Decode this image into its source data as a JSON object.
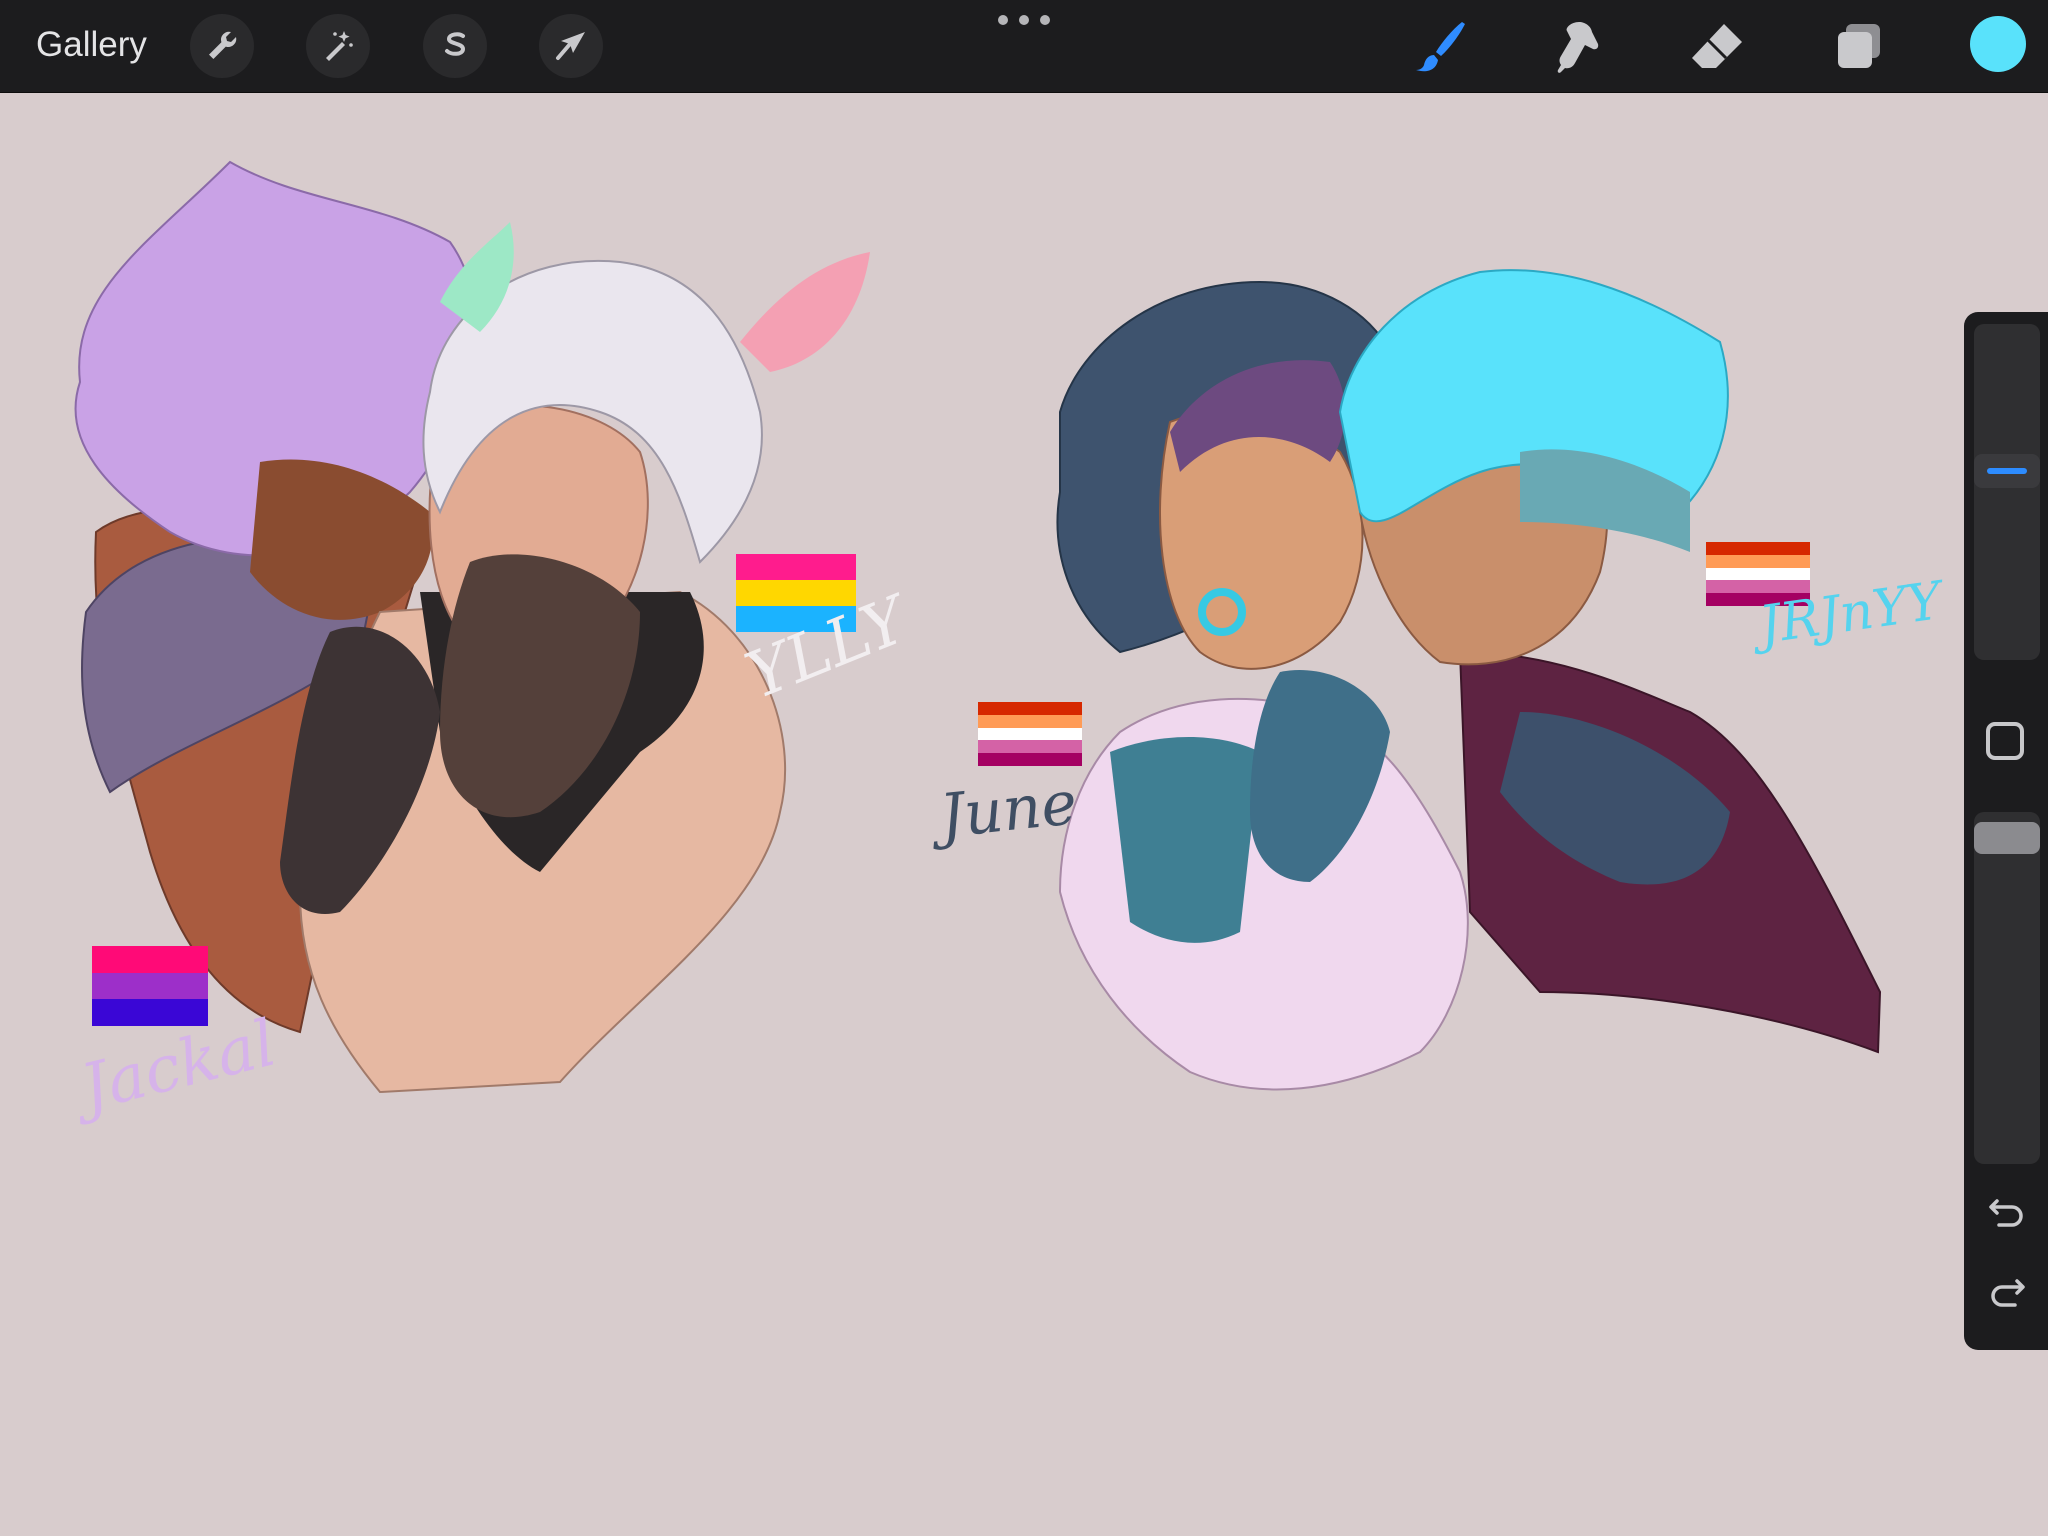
{
  "toolbar": {
    "gallery_label": "Gallery",
    "left_tools": [
      "wrench-icon",
      "magic-wand-icon",
      "selection-icon",
      "transform-arrow-icon"
    ],
    "right_tools": [
      "brush-icon",
      "smudge-icon",
      "eraser-icon",
      "layers-icon"
    ],
    "active_tool": "brush",
    "current_color": "#59e2fb"
  },
  "canvas": {
    "background": "#d8cccd",
    "flags": {
      "pan": [
        "#ff1c8d",
        "#ffd700",
        "#1bb3ff"
      ],
      "bi": [
        "#ff0a77",
        "#9d2fc9",
        "#3a06d6"
      ],
      "lesbian_center": [
        "#d62800",
        "#ff9b56",
        "#ffffff",
        "#d462a6",
        "#a40062"
      ],
      "lesbian_right": [
        "#d62800",
        "#ff9b56",
        "#ffffff",
        "#d462a6",
        "#a40062"
      ]
    },
    "signatures": {
      "top_left": "YLLY",
      "bottom_left": "Jackal",
      "center": "June",
      "right": "JRJnYY"
    }
  },
  "sidebar": {
    "brush_size_level": 0.57,
    "opacity_level": 0.97,
    "controls": [
      "modify-button",
      "undo-icon",
      "redo-icon"
    ]
  }
}
